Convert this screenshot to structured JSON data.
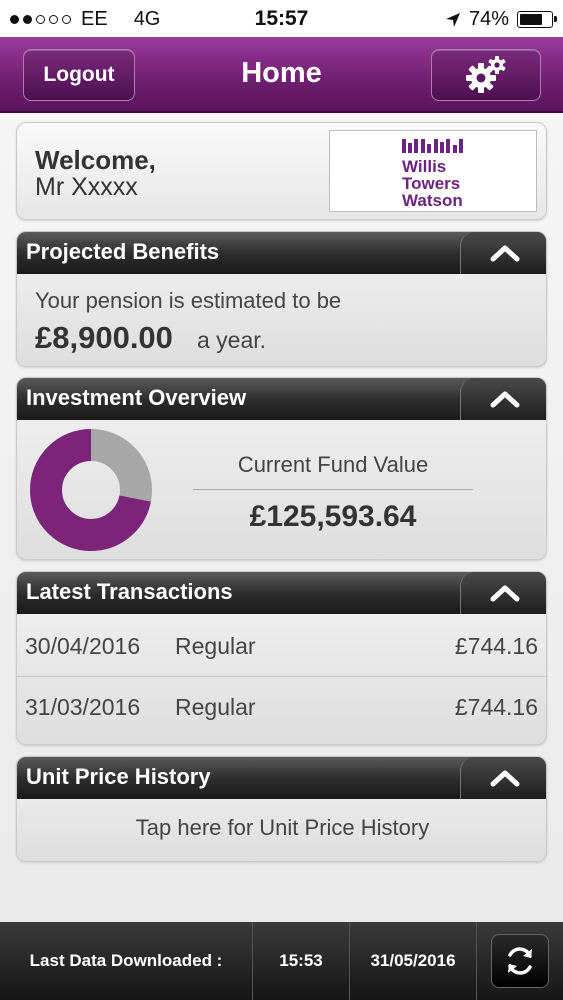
{
  "status_bar": {
    "carrier": "EE",
    "network": "4G",
    "time": "15:57",
    "battery": "74%",
    "battery_level": 0.74,
    "signal_bars_filled": 2,
    "signal_bars_total": 5
  },
  "nav": {
    "title": "Home",
    "logout_label": "Logout",
    "settings_icon": "gear-icon"
  },
  "welcome": {
    "greeting": "Welcome,",
    "name": "Mr Xxxxx",
    "logo_lines": [
      "Willis",
      "Towers",
      "Watson"
    ]
  },
  "projected_benefits": {
    "title": "Projected Benefits",
    "line1": "Your pension is estimated to be",
    "amount": "£8,900.00",
    "suffix": "a year."
  },
  "investment_overview": {
    "title": "Investment Overview",
    "fund_label": "Current Fund Value",
    "fund_value": "£125,593.64",
    "donut_primary_fraction": 0.72
  },
  "latest_transactions": {
    "title": "Latest Transactions",
    "rows": [
      {
        "date": "30/04/2016",
        "type": "Regular",
        "amount": "£744.16"
      },
      {
        "date": "31/03/2016",
        "type": "Regular",
        "amount": "£744.16"
      }
    ]
  },
  "unit_price_history": {
    "title": "Unit Price History",
    "link_text": "Tap here for Unit Price History"
  },
  "bottom_bar": {
    "label": "Last Data Downloaded :",
    "time": "15:53",
    "date": "31/05/2016",
    "refresh_icon": "refresh-icon"
  },
  "colors": {
    "brand_purple": "#6e1e70",
    "donut_purple": "#7b2479",
    "donut_grey": "#a7a7a7",
    "header_dark": "#2b2b2b"
  }
}
